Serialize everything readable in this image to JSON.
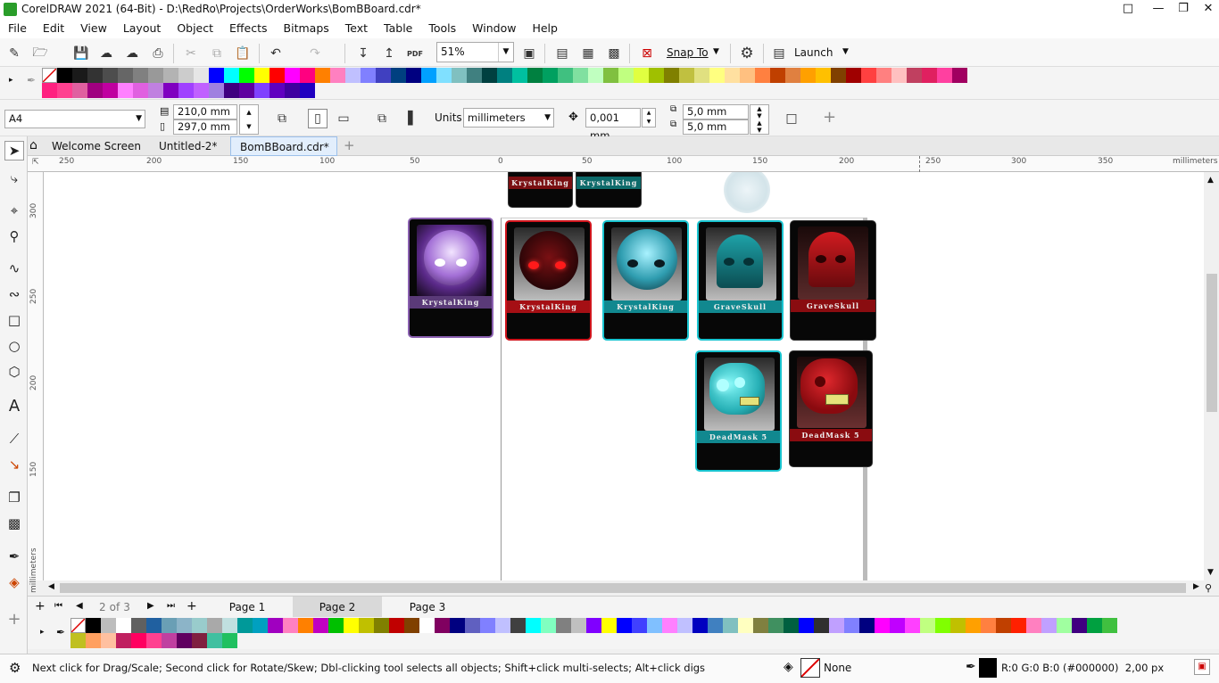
{
  "app": {
    "title": "CorelDRAW 2021 (64-Bit) - D:\\RedRo\\Projects\\OrderWorks\\BomBBoard.cdr*"
  },
  "menu": [
    "File",
    "Edit",
    "View",
    "Layout",
    "Object",
    "Effects",
    "Bitmaps",
    "Text",
    "Table",
    "Tools",
    "Window",
    "Help"
  ],
  "toolbar": {
    "zoom": "51%",
    "snap_to": "Snap To",
    "launch": "Launch",
    "pdf": "PDF"
  },
  "propbar": {
    "page_size": "A4",
    "width": "210,0 mm",
    "height": "297,0 mm",
    "units_label": "Units:",
    "units": "millimeters",
    "nudge": "0,001 mm",
    "dup_x": "5,0 mm",
    "dup_y": "5,0 mm"
  },
  "doc_tabs": [
    {
      "label": "Welcome Screen"
    },
    {
      "label": "Untitled-2*"
    },
    {
      "label": "BomBBoard.cdr*"
    }
  ],
  "ruler": {
    "h_ticks": [
      "250",
      "200",
      "150",
      "100",
      "50",
      "0",
      "50",
      "100",
      "150",
      "200",
      "250",
      "300",
      "350"
    ],
    "h_unit": "millimeters",
    "v_ticks": [
      "300",
      "250",
      "200",
      "150"
    ],
    "v_unit": "millimeters"
  },
  "cards": [
    {
      "label": "KrystalKing"
    },
    {
      "label": "KrystalKing"
    },
    {
      "label": "KrystalKing"
    },
    {
      "label": "KrystalKing"
    },
    {
      "label": "KrystalKing"
    },
    {
      "label": "GraveSkull"
    },
    {
      "label": "GraveSkull"
    },
    {
      "label": "DeadMask 5"
    },
    {
      "label": "DeadMask 5"
    }
  ],
  "pages": {
    "current": "2",
    "of": "of",
    "total": "3",
    "tabs": [
      "Page 1",
      "Page 2",
      "Page 3"
    ]
  },
  "status": {
    "hint": "Next click for Drag/Scale; Second click for Rotate/Skew; Dbl-clicking tool selects all objects; Shift+click multi-selects; Alt+click digs",
    "fill": "None",
    "outline": "R:0 G:0 B:0 (#000000)  2,00 px"
  },
  "palette_top": [
    "#000000",
    "#1a1a1a",
    "#333333",
    "#4d4d4d",
    "#666666",
    "#808080",
    "#999999",
    "#b3b3b3",
    "#cccccc",
    "#e6e6e6",
    "#0000ff",
    "#00ffff",
    "#00ff00",
    "#ffff00",
    "#ff0000",
    "#ff00ff",
    "#ff0080",
    "#ff8000",
    "#ff80c0",
    "#c0c0ff",
    "#8080ff",
    "#4040c0",
    "#004080",
    "#000080",
    "#00a0ff",
    "#80e0ff",
    "#80c0c0",
    "#408080",
    "#004040",
    "#008080",
    "#00c0a0",
    "#008040",
    "#00a060",
    "#40c080",
    "#80e0a0",
    "#c0ffc0",
    "#80c040",
    "#c0ff80",
    "#e0ff40",
    "#a0c000",
    "#808000",
    "#c0c040",
    "#e0e080",
    "#ffff80",
    "#ffe0a0",
    "#ffc080",
    "#ff8040",
    "#c04000",
    "#e08040",
    "#ffa000",
    "#ffc000",
    "#804000",
    "#a00000",
    "#ff4040",
    "#ff8080",
    "#ffc0c0",
    "#c04060",
    "#e02060",
    "#ff40a0",
    "#a00060"
  ],
  "palette_top2": [
    "#ff2080",
    "#ff4090",
    "#e060a0",
    "#a00080",
    "#c000a0",
    "#ff80ff",
    "#e060e0",
    "#c080e0",
    "#8000c0",
    "#a040ff",
    "#c060ff",
    "#a080e0",
    "#400080",
    "#6000a0",
    "#8040ff",
    "#6000c0",
    "#4000a0",
    "#2000c0"
  ],
  "palette_bot": [
    "#000000",
    "#bdbdbd",
    "#ffffff",
    "#606060",
    "#2060a0",
    "#6a9fb5",
    "#8cb4c8",
    "#99cccc",
    "#a9a9a9",
    "#c0e0e0",
    "#009999",
    "#00a0c0",
    "#a000c0",
    "#ff80c0",
    "#ff8000",
    "#c000c0",
    "#00c000",
    "#ffff00",
    "#c0c000",
    "#808000",
    "#c00000",
    "#804000",
    "#ffffff",
    "#800060",
    "#000080",
    "#6060c0",
    "#8080ff",
    "#c0c0ff",
    "#404040",
    "#00ffff",
    "#80ffc0",
    "#808080",
    "#c0c0c0",
    "#8000ff",
    "#ffff00",
    "#0000ff",
    "#4040ff",
    "#80c0ff",
    "#ff80ff",
    "#c0c0ff",
    "#0000c0",
    "#4080c0",
    "#80c0c0",
    "#ffffc0",
    "#808040",
    "#409060",
    "#006040",
    "#0000ff",
    "#303030",
    "#c0a0ff",
    "#8080ff",
    "#000080",
    "#ff00ff",
    "#c000ff",
    "#ff40ff",
    "#c0ff80",
    "#80ff00",
    "#c0c000",
    "#ffa000",
    "#ff8040",
    "#c04000",
    "#ff2000",
    "#ff80c0",
    "#c0a0ff",
    "#a0ffa0",
    "#400080",
    "#00a040",
    "#40c040"
  ],
  "palette_bot2": [
    "#c0c020",
    "#ffa060",
    "#ffc0a0",
    "#c02060",
    "#ff0060",
    "#ff4090",
    "#c040a0",
    "#600060",
    "#802040",
    "#40c0a0",
    "#20c060"
  ]
}
